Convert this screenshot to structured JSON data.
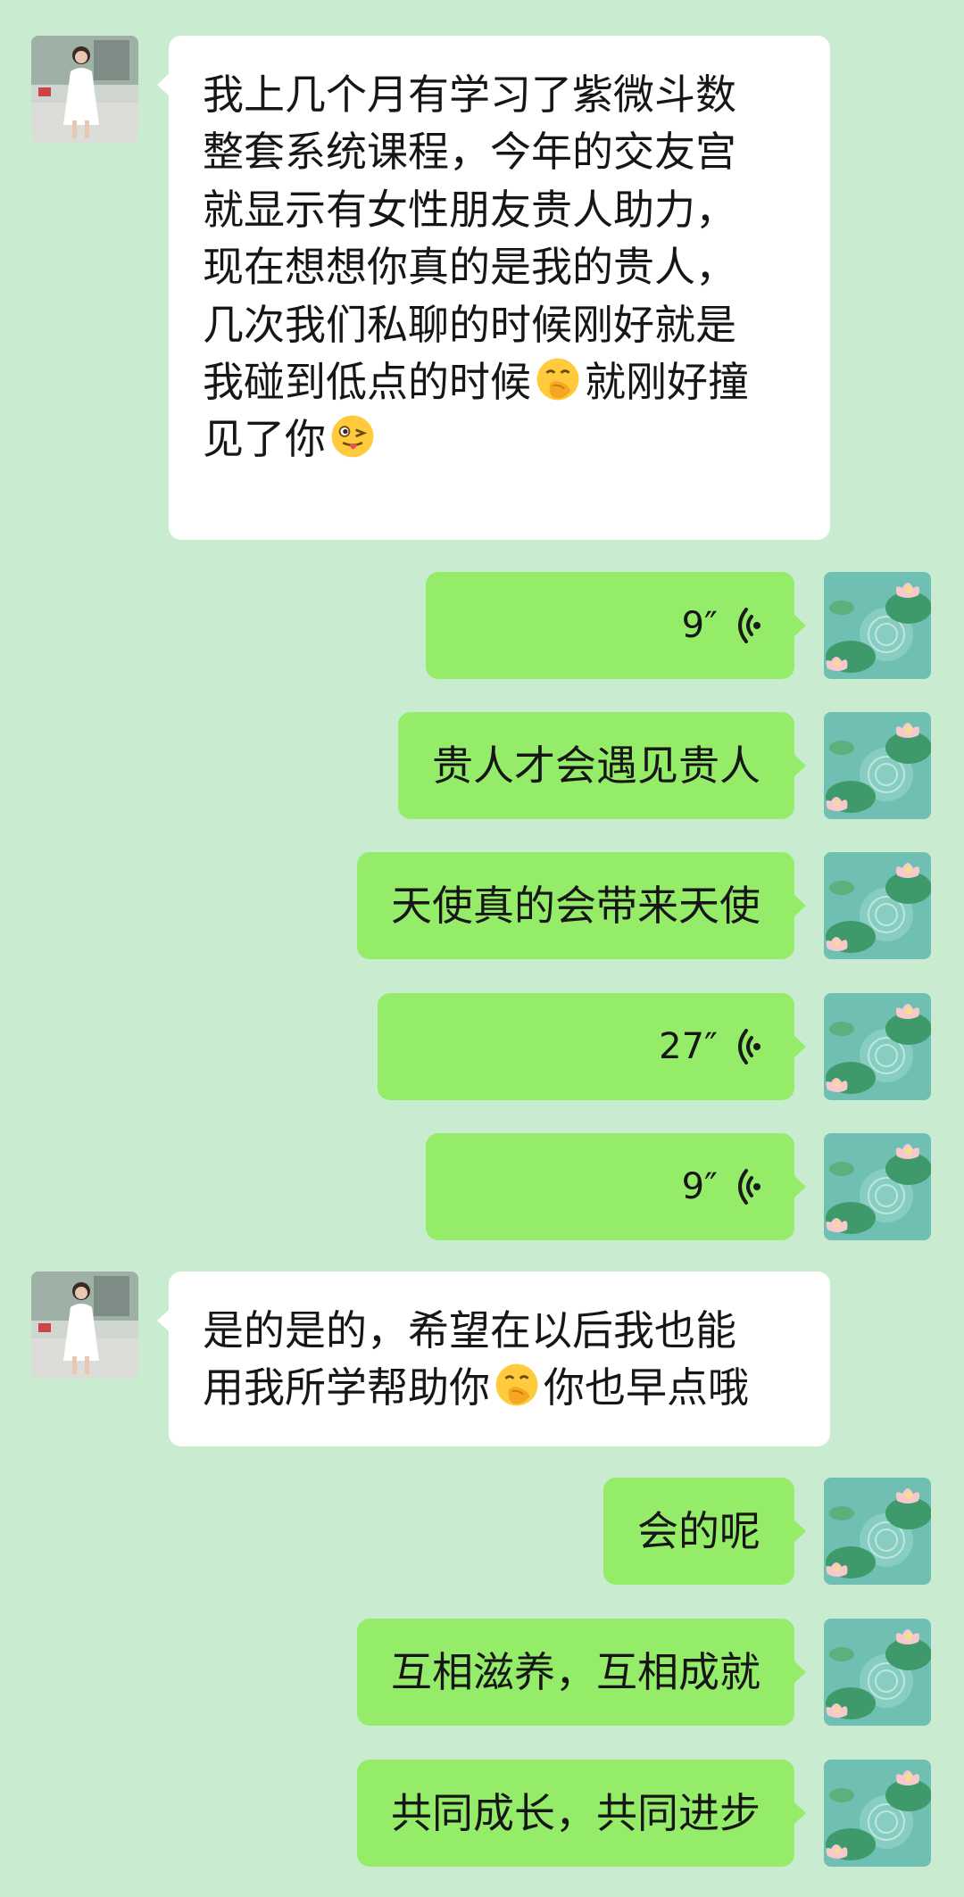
{
  "messages": [
    {
      "sender": "contact",
      "type": "text",
      "lines": [
        "我上几个月有学习了紫微斗数",
        "整套系统课程，今年的交友宫",
        "就显示有女性朋友贵人助力，",
        "现在想想你真的是我的贵人，",
        "几次我们私聊的时候刚好就是",
        [
          "我碰到低点的时候",
          "就刚好撞"
        ],
        [
          "见了你",
          ""
        ]
      ],
      "emojis": [
        "hand-over-mouth-emoji",
        "winking-tongue-emoji"
      ]
    },
    {
      "sender": "me",
      "type": "voice",
      "duration": "9″"
    },
    {
      "sender": "me",
      "type": "text",
      "text": "贵人才会遇见贵人"
    },
    {
      "sender": "me",
      "type": "text",
      "text": "天使真的会带来天使"
    },
    {
      "sender": "me",
      "type": "voice",
      "duration": "27″"
    },
    {
      "sender": "me",
      "type": "voice",
      "duration": "9″"
    },
    {
      "sender": "contact",
      "type": "text",
      "lines": [
        "是的是的，希望在以后我也能",
        [
          "用我所学帮助你",
          "你也早点哦"
        ]
      ],
      "emojis": [
        "hand-over-mouth-emoji"
      ]
    },
    {
      "sender": "me",
      "type": "text",
      "text": "会的呢"
    },
    {
      "sender": "me",
      "type": "text",
      "text": "互相滋养，互相成就"
    },
    {
      "sender": "me",
      "type": "text",
      "text": "共同成长，共同进步"
    }
  ],
  "avatars": {
    "contact": "girl-in-white-dress-photo",
    "me": "lotus-pond-illustration"
  },
  "colors": {
    "background": "#c9ecd1",
    "my_bubble": "#95ec69",
    "their_bubble": "#ffffff"
  }
}
